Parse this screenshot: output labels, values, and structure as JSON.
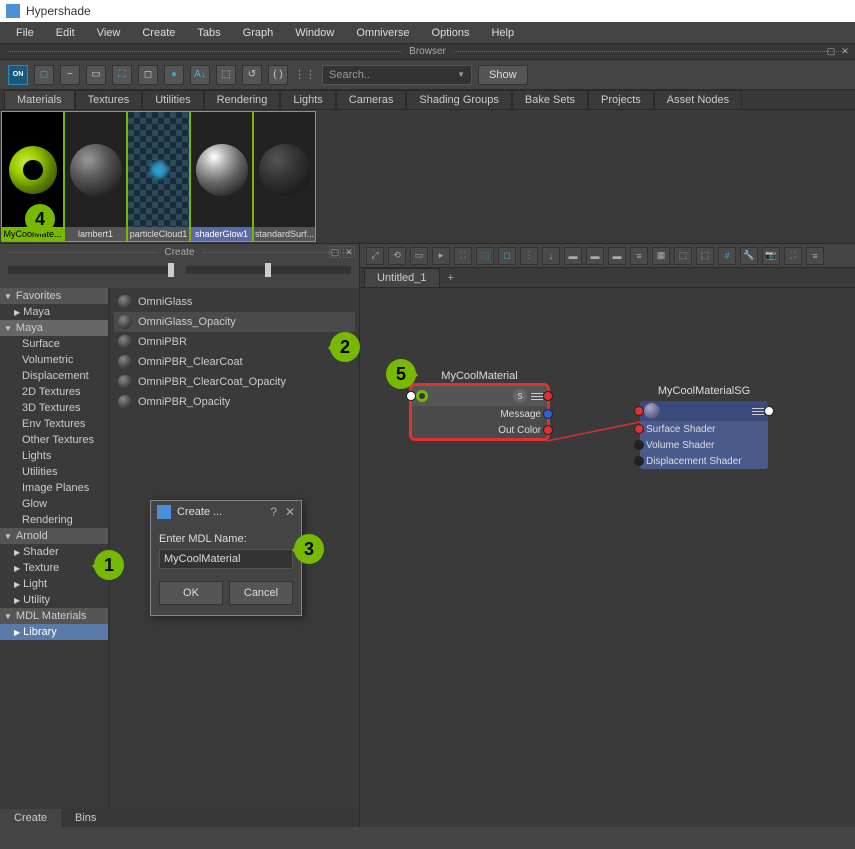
{
  "window_title": "Hypershade",
  "menu": [
    "File",
    "Edit",
    "View",
    "Create",
    "Tabs",
    "Graph",
    "Window",
    "Omniverse",
    "Options",
    "Help"
  ],
  "browser_label": "Browser",
  "search_placeholder": "Search..",
  "show_label": "Show",
  "material_tabs": [
    "Materials",
    "Textures",
    "Utilities",
    "Rendering",
    "Lights",
    "Cameras",
    "Shading Groups",
    "Bake Sets",
    "Projects",
    "Asset Nodes"
  ],
  "thumbnails": [
    {
      "label": "MyCoolMate...",
      "style": "sel"
    },
    {
      "label": "lambert1",
      "style": "gray"
    },
    {
      "label": "particleCloud1",
      "style": "gray"
    },
    {
      "label": "shaderGlow1",
      "style": "blue"
    },
    {
      "label": "standardSurf...",
      "style": "gray"
    }
  ],
  "create_label": "Create",
  "categories": {
    "favorites": "Favorites",
    "maya": "Maya",
    "maya_items": [
      "Surface",
      "Volumetric",
      "Displacement",
      "2D Textures",
      "3D Textures",
      "Env Textures",
      "Other Textures",
      "Lights",
      "Utilities",
      "Image Planes",
      "Glow",
      "Rendering"
    ],
    "arnold": "Arnold",
    "arnold_items": [
      "Shader",
      "Texture",
      "Light",
      "Utility"
    ],
    "mdl": "MDL Materials",
    "library": "Library"
  },
  "shaders": [
    "OmniGlass",
    "OmniGlass_Opacity",
    "OmniPBR",
    "OmniPBR_ClearCoat",
    "OmniPBR_ClearCoat_Opacity",
    "OmniPBR_Opacity"
  ],
  "bottom_tabs": [
    "Create",
    "Bins"
  ],
  "graph_tab": "Untitled_1",
  "node1": {
    "title": "MyCoolMaterial",
    "rows": [
      "Message",
      "Out Color"
    ]
  },
  "node2": {
    "title": "MyCoolMaterialSG",
    "rows": [
      "Surface Shader",
      "Volume Shader",
      "Displacement Shader"
    ]
  },
  "dialog": {
    "title": "Create ...",
    "label": "Enter MDL Name:",
    "value": "MyCoolMaterial",
    "ok": "OK",
    "cancel": "Cancel"
  },
  "callouts": [
    "1",
    "2",
    "3",
    "4",
    "5"
  ]
}
